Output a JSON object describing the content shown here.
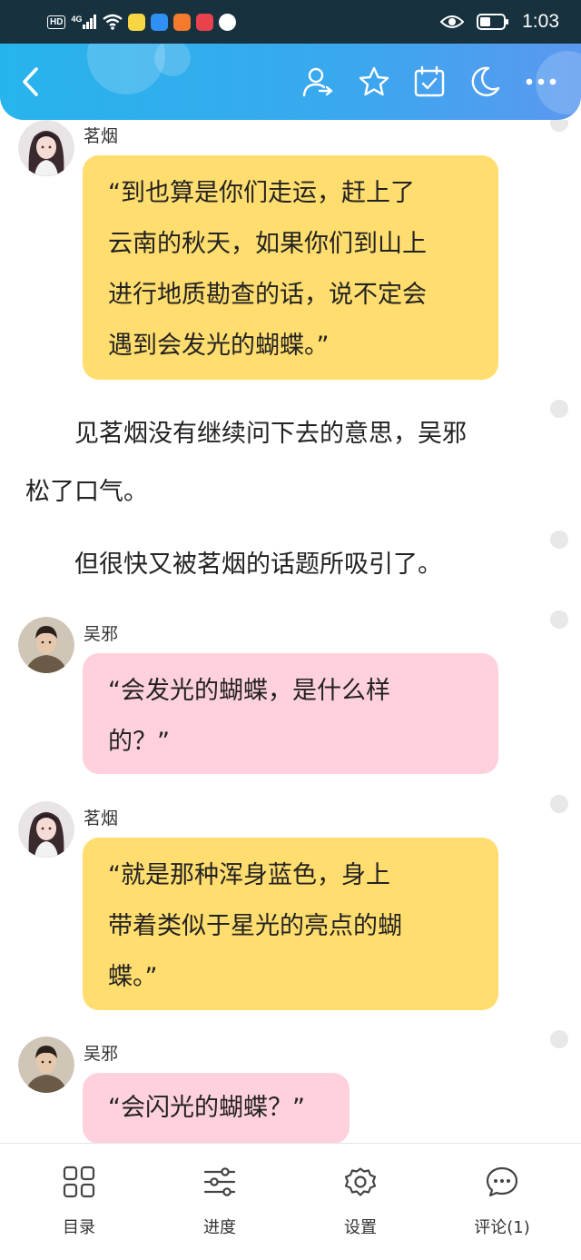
{
  "status_bar": {
    "hd_label": "HD",
    "signal_label": "4G",
    "time": "1:03"
  },
  "header": {
    "icons": [
      "back-arrow-icon",
      "author-user-icon",
      "star-icon",
      "calendar-check-icon",
      "moon-icon",
      "more-icon"
    ],
    "accent_color": "#2fb0ee"
  },
  "messages": [
    {
      "type": "chat",
      "speaker": "茗烟",
      "color": "#ffdd6e",
      "lines": [
        "“到也算是你们走运，赶上了",
        "云南的秋天，如果你们到山上",
        "进行地质勘查的话，说不定会",
        "遇到会发光的蝴蝶。”"
      ]
    },
    {
      "type": "narration",
      "lines": [
        "　　见茗烟没有继续问下去的意思，吴邪",
        "松了口气。"
      ]
    },
    {
      "type": "narration",
      "lines": [
        "　　但很快又被茗烟的话题所吸引了。"
      ]
    },
    {
      "type": "chat",
      "speaker": "吴邪",
      "color": "#ffd1dc",
      "lines": [
        "“会发光的蝴蝶，是什么样",
        "的？”"
      ]
    },
    {
      "type": "chat",
      "speaker": "茗烟",
      "color": "#ffdd6e",
      "lines": [
        "“就是那种浑身蓝色，身上",
        "带着类似于星光的亮点的蝴",
        "蝶。”"
      ]
    },
    {
      "type": "chat",
      "speaker": "吴邪",
      "color": "#ffd1dc",
      "lines": [
        "“会闪光的蝴蝶？”"
      ]
    }
  ],
  "bottom_nav": {
    "items": [
      {
        "label": "目录",
        "icon": "grid-catalog-icon"
      },
      {
        "label": "进度",
        "icon": "sliders-progress-icon"
      },
      {
        "label": "设置",
        "icon": "gear-settings-icon"
      },
      {
        "label": "评论(1)",
        "icon": "comment-bubble-icon"
      }
    ]
  }
}
